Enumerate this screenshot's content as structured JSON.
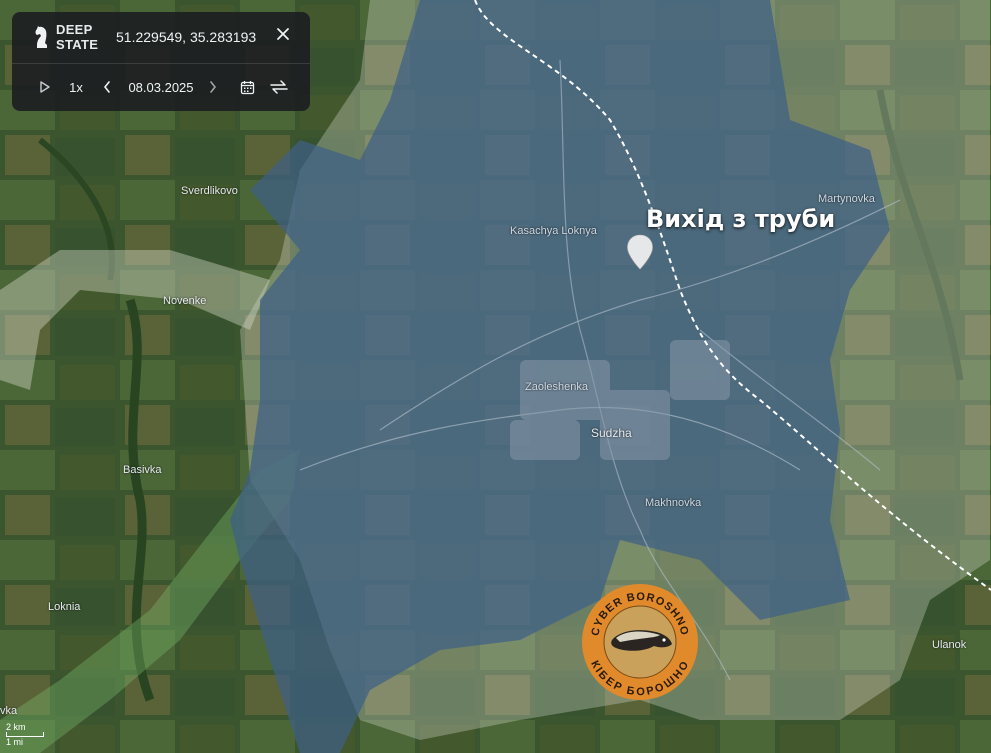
{
  "panel": {
    "brand_line1": "DEEP",
    "brand_line2": "STATE",
    "coordinates": "51.229549, 35.283193",
    "speed": "1x",
    "date": "08.03.2025"
  },
  "icons": {
    "logo": "knight-chess-icon",
    "close": "close-icon",
    "play": "play-icon",
    "prev": "chevron-left-icon",
    "next": "chevron-right-icon",
    "calendar": "calendar-icon",
    "compare": "compare-arrows-icon",
    "marker": "map-pin-icon"
  },
  "map": {
    "callout": "Вихід з труби",
    "places": {
      "sverdlikovo": "Sverdlikovo",
      "novenke": "Novenke",
      "basivka": "Basivka",
      "loknia": "Loknia",
      "kasachya_loknya": "Kasachya Loknya",
      "martynovka": "Martynovka",
      "zaoleshenka": "Zaoleshenka",
      "sudzha": "Sudzha",
      "makhnovka": "Makhnovka",
      "ulanok": "Ulanok",
      "bottom_left_partial": "vka"
    },
    "scale_km": "2 km",
    "scale_mi": "1 mi"
  },
  "badge": {
    "text_top": "CYBER BOROSHNO",
    "text_bottom": "КІБЕР БОРОШНО"
  },
  "colors": {
    "occupied_zone": "#3f5f86",
    "grey_zone": "#c9d1c1",
    "panel_bg": "#1c1e22",
    "badge_ring": "#e08a2b"
  }
}
